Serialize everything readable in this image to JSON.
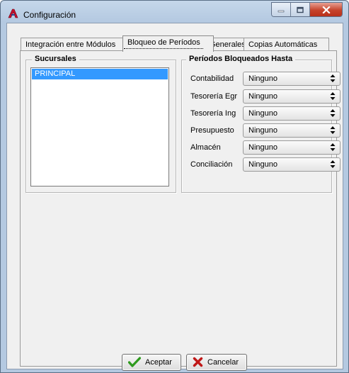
{
  "window": {
    "title": "Configuración",
    "icon": "app-logo-a-icon"
  },
  "tabs": [
    {
      "label": "Integración entre Módulos"
    },
    {
      "label": "Bloqueo de Períodos"
    },
    {
      "label": "Generales"
    },
    {
      "label": "Copias Automáticas"
    }
  ],
  "active_tab": "Bloqueo de Períodos",
  "branches": {
    "title": "Sucursales",
    "items": [
      "PRINCIPAL"
    ],
    "selected": "PRINCIPAL"
  },
  "periods": {
    "title": "Períodos Bloqueados Hasta",
    "rows": [
      {
        "label": "Contabilidad",
        "value": "Ninguno"
      },
      {
        "label": "Tesorería Egr",
        "value": "Ninguno"
      },
      {
        "label": "Tesorería Ing",
        "value": "Ninguno"
      },
      {
        "label": "Presupuesto",
        "value": "Ninguno"
      },
      {
        "label": "Almacén",
        "value": "Ninguno"
      },
      {
        "label": "Conciliación",
        "value": "Ninguno"
      }
    ]
  },
  "buttons": {
    "accept": "Aceptar",
    "cancel": "Cancelar"
  },
  "colors": {
    "selection": "#3399ff",
    "accept_icon": "#2e9a1e",
    "cancel_icon": "#c01818"
  }
}
